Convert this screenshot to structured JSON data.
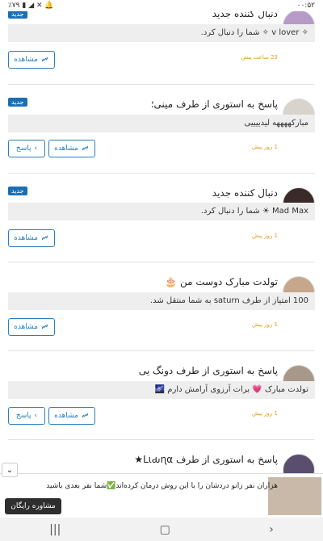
{
  "status": {
    "time": "۰۰:۵۲",
    "battery": "٪۷۹"
  },
  "buttons": {
    "view": "مشاهده",
    "reply": "پاسخ"
  },
  "notifications": [
    {
      "title": "دنبال کننده جدید",
      "badge": "جدید",
      "message": "✧ v lover ✧ شما را دنبال کرد.",
      "time": "23 ساعت پیش",
      "has_reply": false
    },
    {
      "title": "پاسخ به استوری از طرف مینی؛",
      "badge": "جدید",
      "message": "مبارکههههه لیدییییی",
      "time": "1 روز پیش",
      "has_reply": true
    },
    {
      "title": "دنبال کننده جدید",
      "badge": "جدید",
      "message": "Mad Max ☀ شما را دنبال کرد.",
      "time": "1 روز پیش",
      "has_reply": false
    },
    {
      "title": "تولدت مبارک دوست من 🎂",
      "badge": "",
      "message": "100 امتیاز از طرف saturn به شما منتقل شد.",
      "time": "1 روز پیش",
      "has_reply": false
    },
    {
      "title": "پاسخ به استوری از طرف دونگ یی",
      "badge": "",
      "message": "تولدت مبارک 💗 برات آرزوی آرامش دارم 🌌",
      "time": "1 روز پیش",
      "has_reply": true
    },
    {
      "title": "پاسخ به استوری از طرف Lιԃɳα★",
      "badge": "",
      "message": "",
      "time": "",
      "has_reply": false
    }
  ],
  "ad": {
    "text": "هزاران نفر زانو دردشان را با این روش درمان کرده‌اند✅شما نفر بعدی باشید",
    "cta": "مشاوره رایگان"
  }
}
